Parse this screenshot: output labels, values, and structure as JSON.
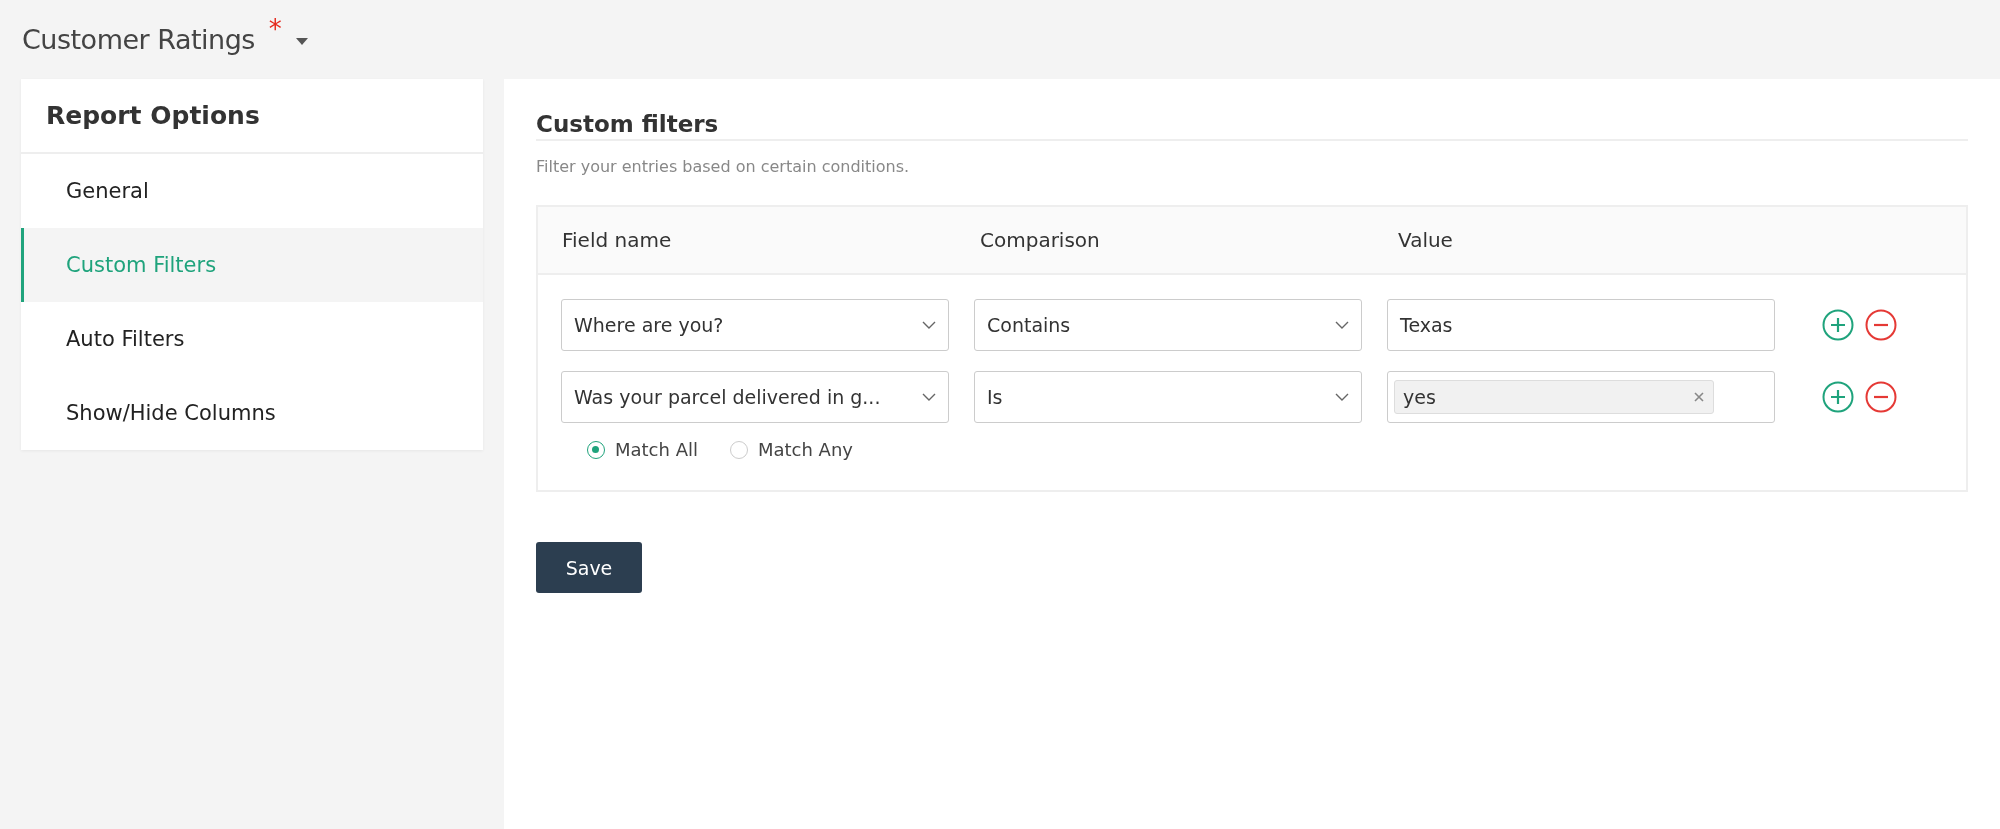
{
  "page": {
    "title": "Customer Ratings",
    "required_mark": "*"
  },
  "sidebar": {
    "title": "Report Options",
    "items": [
      {
        "label": "General",
        "selected": false
      },
      {
        "label": "Custom Filters",
        "selected": true
      },
      {
        "label": "Auto Filters",
        "selected": false
      },
      {
        "label": "Show/Hide Columns",
        "selected": false
      }
    ]
  },
  "panel": {
    "title": "Custom filters",
    "description": "Filter your entries based on certain conditions.",
    "table": {
      "columns": [
        "Field name",
        "Comparison",
        "Value"
      ],
      "rows": [
        {
          "field": "Where are you?",
          "comparison": "Contains",
          "value": {
            "kind": "text",
            "text": "Texas"
          }
        },
        {
          "field": "Was your parcel delivered in g...",
          "comparison": "Is",
          "value": {
            "kind": "tag",
            "text": "yes"
          }
        }
      ],
      "match": [
        {
          "label": "Match All",
          "selected": true
        },
        {
          "label": "Match Any",
          "selected": false
        }
      ]
    },
    "save_button": "Save"
  }
}
